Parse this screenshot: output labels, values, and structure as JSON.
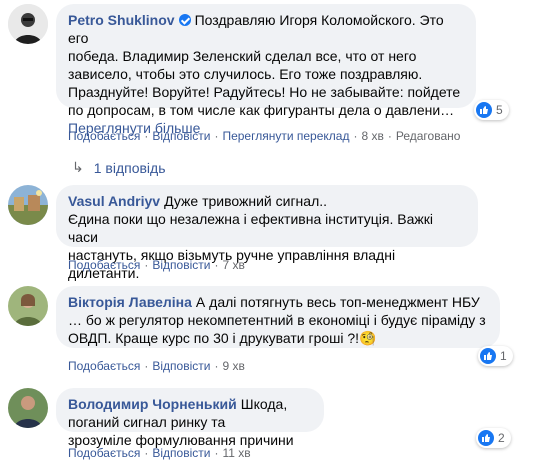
{
  "actions": {
    "like": "Подобається",
    "reply": "Відповісти",
    "see_translation": "Переглянути переклад",
    "edited": "Редаговано",
    "dot": "·"
  },
  "colors": {
    "bubble": "#f0f2f5",
    "name_link": "#385898",
    "meta": "#65676b",
    "like_blue": "#1877f2"
  },
  "comments": [
    {
      "author": "Petro Shuklinov",
      "verified": true,
      "avatar_icon": "person-avatar-icon",
      "lines": [
        "Поздравляю Игоря Коломойского. Это его",
        "победа. Владимир Зеленский сделал все, что от него",
        "зависело, чтобы это случилось. Его тоже поздравляю.",
        "Празднуйте! Воруйте! Радуйтесь! Но не забывайте: пойдете",
        "по допросам, в том числе как фигуранты дела о давлени…"
      ],
      "see_more": "Переглянути більше",
      "time": "8 хв",
      "reactions": "5",
      "replies": "1 відповідь"
    },
    {
      "author": "Vasul Andriyv",
      "avatar_icon": "landscape-avatar-icon",
      "first_line": "Дуже тривожний сигнал..",
      "lines": [
        "Єдина поки що незалежна і ефективна інституція. Важкі часи",
        "настануть, якщо візьмуть ручне управління владні дилетанти."
      ],
      "time": "7 хв"
    },
    {
      "author": "Вікторія Лавеліна",
      "avatar_icon": "person-avatar-icon",
      "first_line": "А далі потягнуть весь топ-менеджмент НБУ",
      "lines": [
        "… бо ж регулятор некомпетентний в економіці і будує піраміду з",
        "ОВДП. Краще курс по 30 і друкувати гроші ?!"
      ],
      "emoji": "🧐",
      "time": "9 хв",
      "reactions": "1"
    },
    {
      "author": "Володимир Чорненький",
      "avatar_icon": "person-avatar-icon",
      "first_line": "Шкода, поганий сигнал ринку та",
      "lines": [
        "зрозуміле формулювання причини"
      ],
      "time": "11 хв",
      "reactions": "2"
    }
  ]
}
